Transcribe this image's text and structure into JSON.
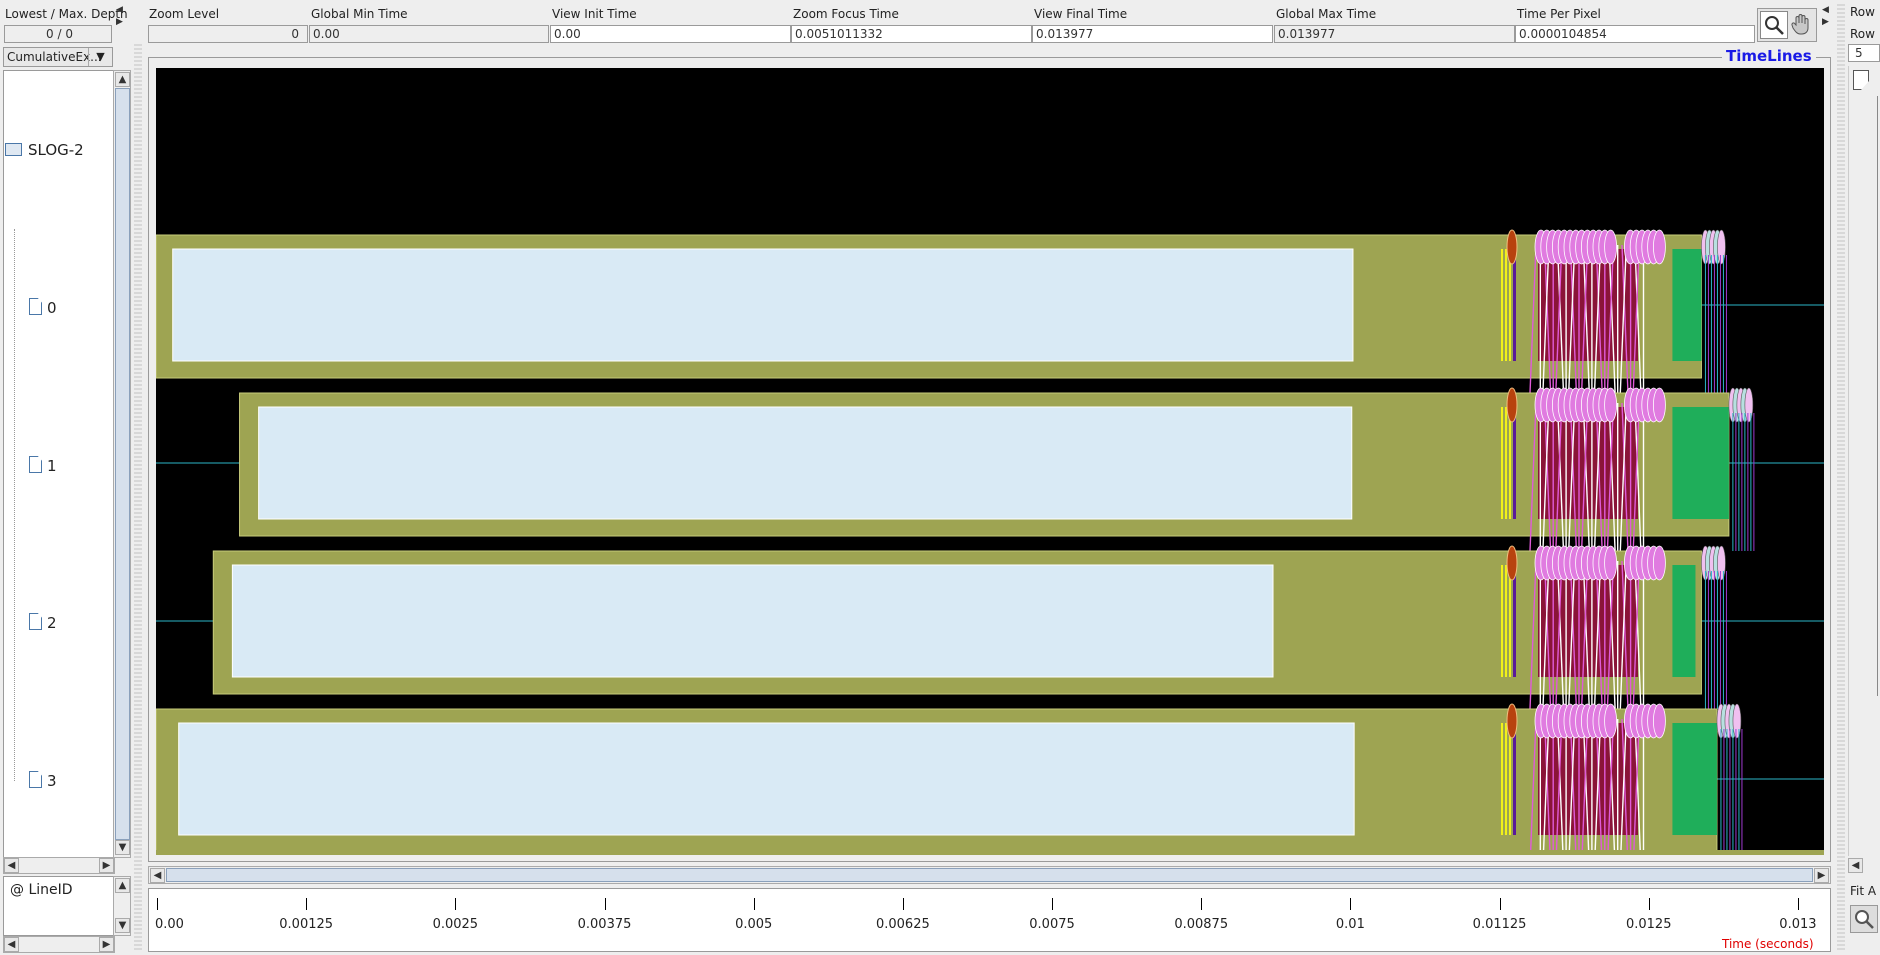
{
  "top": {
    "depth_label": "Lowest / Max. Depth",
    "depth_value": "0 / 0",
    "zoom_level_label": "Zoom Level",
    "zoom_level": "0",
    "global_min_label": "Global Min Time",
    "global_min": "0.00",
    "view_init_label": "View  Init Time",
    "view_init": "0.00",
    "zoom_focus_label": "Zoom Focus Time",
    "zoom_focus": "0.0051011332",
    "view_final_label": "View Final Time",
    "view_final": "0.013977",
    "global_max_label": "Global Max Time",
    "global_max": "0.013977",
    "time_per_pixel_label": "Time Per Pixel",
    "time_per_pixel": "0.0000104854",
    "row_label_1": "Row",
    "row_label_2": "Row",
    "row_value": "5"
  },
  "left_panel": {
    "dropdown_value": "CumulativeEx...",
    "root": "SLOG-2",
    "items": [
      {
        "label": "0"
      },
      {
        "label": "1"
      },
      {
        "label": "2"
      },
      {
        "label": "3"
      }
    ],
    "lineid_label": "@ LineID"
  },
  "canvas": {
    "title": "TimeLines",
    "axis_title": "Time (seconds)",
    "ticks": [
      "0.00",
      "0.00125",
      "0.0025",
      "0.00375",
      "0.005",
      "0.00625",
      "0.0075",
      "0.00875",
      "0.01",
      "0.01125",
      "0.0125",
      "0.013"
    ]
  },
  "right_panel": {
    "fit_label": "Fit A"
  },
  "colors": {
    "background": "#000000",
    "outer_state": "#9ea452",
    "inner_state": "#d9eaf5",
    "late_state": "#1fae5a",
    "event_magenta": "#e07be0",
    "event_orange": "#b8420e",
    "dark_red": "#8a1438",
    "title_blue": "#1a1ae6",
    "axis_red": "#e00000"
  },
  "timeline_rows": [
    {
      "label": "0",
      "outer": [
        0,
        0.01295
      ],
      "inner": [
        0.00014,
        0.01003
      ],
      "late": [
        0.01145,
        0.01295
      ]
    },
    {
      "label": "1",
      "outer": [
        0.0007,
        0.01318
      ],
      "inner": [
        0.00086,
        0.01002
      ],
      "late": [
        0.01145,
        0.01318
      ]
    },
    {
      "label": "2",
      "outer": [
        0.00048,
        0.01295
      ],
      "inner": [
        0.00064,
        0.00936
      ],
      "late": [
        0.01145,
        0.0129
      ]
    },
    {
      "label": "3",
      "outer": [
        0,
        0.01308
      ],
      "inner": [
        0.00019,
        0.01004
      ],
      "late": [
        0.01145,
        0.01308
      ]
    }
  ]
}
